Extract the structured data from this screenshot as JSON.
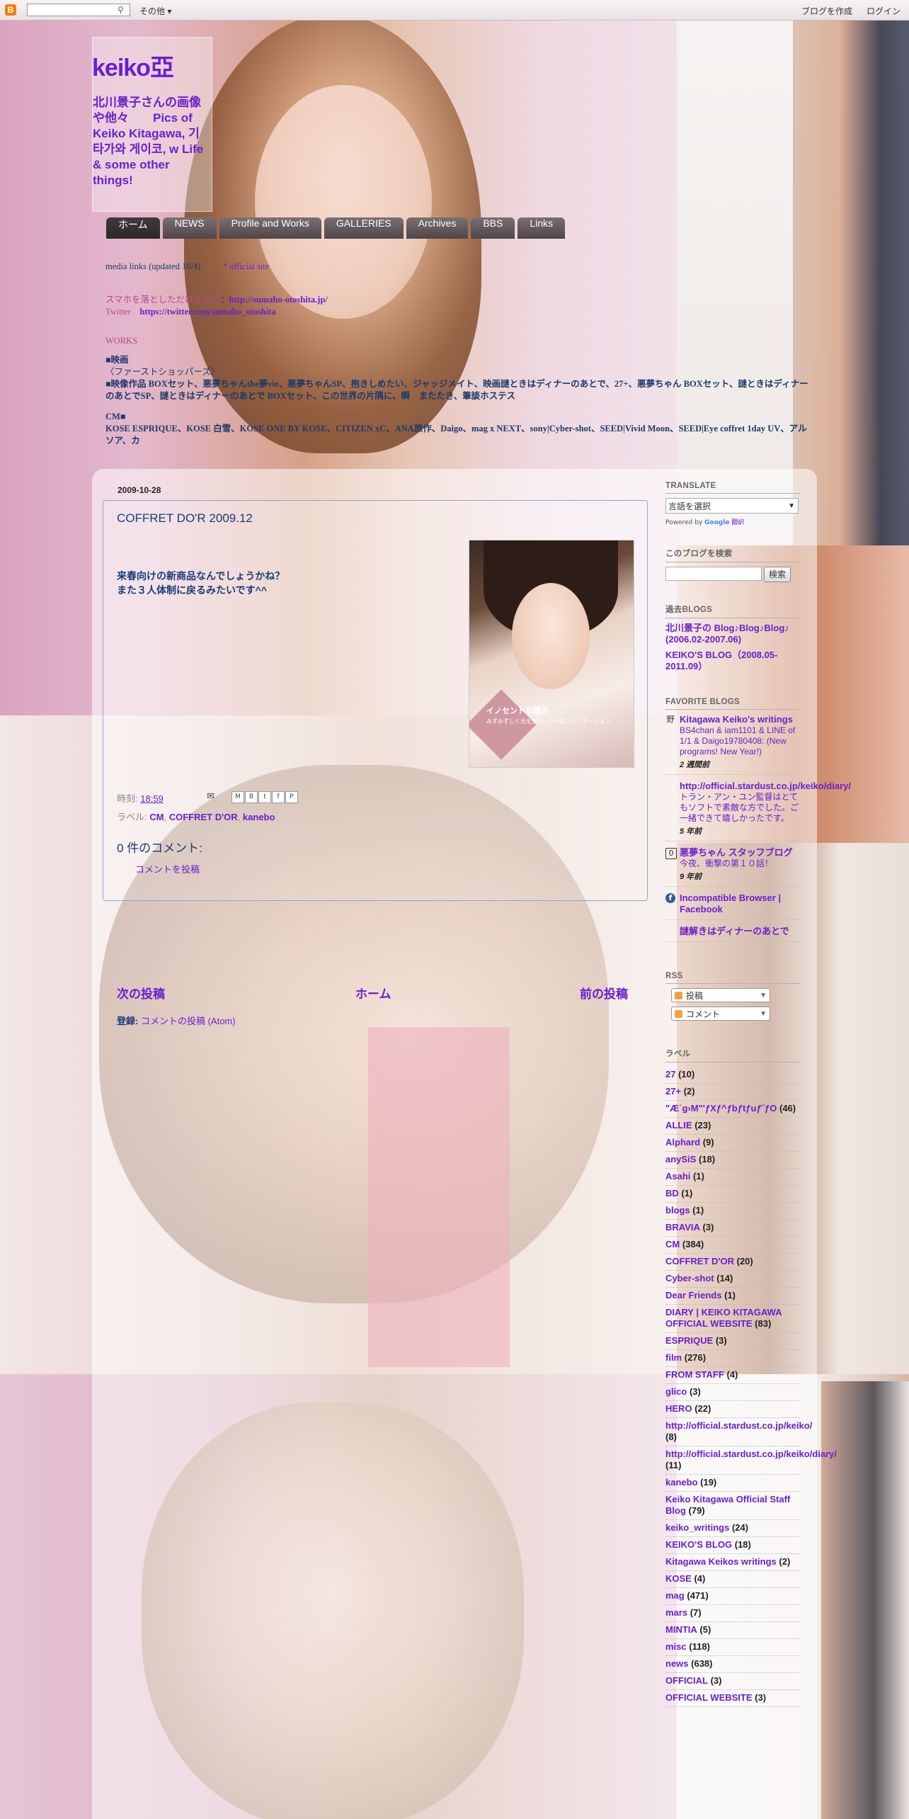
{
  "navbar": {
    "more": "その他",
    "create_blog": "ブログを作成",
    "login": "ログイン"
  },
  "header": {
    "title": "keiko亞",
    "description": "北川景子さんの画像や他々　　Pics of Keiko Kitagawa, 기타가와 게이코, w Life & some other things!"
  },
  "tabs": [
    {
      "label": "ホーム",
      "active": true
    },
    {
      "label": "NEWS"
    },
    {
      "label": "Profile and Works"
    },
    {
      "label": "GALLERIES"
    },
    {
      "label": "Archives"
    },
    {
      "label": "BBS"
    },
    {
      "label": "Links"
    }
  ],
  "info": {
    "line1_a": "media links (updated 10/4)",
    "line1_b": "* official site",
    "line2_label": "スマホを落としただけなのに",
    "line2_url": "：http://sumaho-otoshita.jp/",
    "line3_label": "Twitter",
    "line3_url": "https://twitter.com/sumaho_otoshita",
    "works_head": "WORKS",
    "works_l1": "■映画",
    "works_l2": "〈ファーストショッパーズ〉",
    "works_l3": "■映像作品 BOXセット、悪夢ちゃんthe夢vie、悪夢ちゃんSP、抱きしめたい、ジャッジメイト、映画謎ときはディナーのあとで、27+、悪夢ちゃん BOXセット、謎ときはディナーのあとでSP、謎ときはディナーのあとで BOXセット、この世界の片隅に、瞬　またたき、筆談ホステス",
    "cm_head": "CM■",
    "cm_l1": "KOSE ESPRIQUE、KOSE 白雪、KOSE ONE BY KOSE、CITIZEN xC、ANA旅作、Daigo、mag x NEXT、sony|Cyber-shot、SEED|Vivid Moon、SEED|Eye coffret 1day UV、アルソア、カ"
  },
  "post": {
    "date": "2009-10-28",
    "title": "COFFRET DO'R 2009.12",
    "body_l1": "来春向けの新商品なんでしょうかね？",
    "body_l2": "また３人体制に戻るみたいです^^",
    "image_text": "イノセントな輝き",
    "image_subtext": "みずみずしく光を放つ、ツヤ肌ファンデーション",
    "time_label": "時刻:",
    "time": "18:59",
    "labels_label": "ラベル:",
    "labels": [
      "CM",
      "COFFRET D'OR",
      "kanebo"
    ],
    "comments_count": "0 件のコメント:",
    "post_comment": "コメントを投稿"
  },
  "pager": {
    "newer": "次の投稿",
    "home": "ホーム",
    "older": "前の投稿"
  },
  "feed": {
    "label": "登録:",
    "link": "コメントの投稿 (Atom)"
  },
  "sidebar": {
    "translate_head": "TRANSLATE",
    "translate_select": "言語を選択",
    "powered_by": "Powered by",
    "google": "Google",
    "translate_word": "翻訳",
    "search_head": "このブログを検索",
    "search_button": "検索",
    "past_head": "過去BLOGS",
    "past_links": [
      "北川景子の Blog♪Blog♪Blog♪ (2006.02-2007.06)",
      "KEIKO'S BLOG（2008.05-2011.09）"
    ],
    "fav_head": "FAVORITE BLOGS",
    "fav": [
      {
        "icon": "野",
        "title": "Kitagawa Keiko's writings",
        "snippet": "BS4chan & iam1101 & LINE of 1/1 & Daigo19780408: (New programs! New Year!)",
        "time": "2 週間前"
      },
      {
        "icon": "",
        "title": "http://official.stardust.co.jp/keiko/diary/",
        "snippet": "トラン・アン・ユン監督はとてもソフトで素敵な方でした。ご一緒できて嬉しかったです。",
        "time": "5 年前"
      },
      {
        "icon": "0",
        "title": "悪夢ちゃん スタッフブログ",
        "snippet": "今夜、衝撃の第１０話！",
        "time": "9 年前"
      },
      {
        "icon": "f",
        "title": "Incompatible Browser | Facebook",
        "snippet": "",
        "time": ""
      },
      {
        "icon": "",
        "title": "謎解きはディナーのあとで",
        "snippet": "",
        "time": ""
      }
    ],
    "rss_head": "RSS",
    "rss_posts": "投稿",
    "rss_comments": "コメント",
    "labels_head": "ラベル",
    "labels": [
      {
        "name": "27",
        "count": "(10)"
      },
      {
        "name": "27+",
        "count": "(2)"
      },
      {
        "name": "\"Æ˙g›M\"'ƒXƒ^ƒbƒtƒuƒ˝ƒO",
        "count": "(46)"
      },
      {
        "name": "ALLIE",
        "count": "(23)"
      },
      {
        "name": "Alphard",
        "count": "(9)"
      },
      {
        "name": "anySiS",
        "count": "(18)"
      },
      {
        "name": "Asahi",
        "count": "(1)"
      },
      {
        "name": "BD",
        "count": "(1)"
      },
      {
        "name": "blogs",
        "count": "(1)"
      },
      {
        "name": "BRAVIA",
        "count": "(3)"
      },
      {
        "name": "CM",
        "count": "(384)"
      },
      {
        "name": "COFFRET D'OR",
        "count": "(20)"
      },
      {
        "name": "Cyber-shot",
        "count": "(14)"
      },
      {
        "name": "Dear Friends",
        "count": "(1)"
      },
      {
        "name": "DIARY | KEIKO KITAGAWA OFFICIAL WEBSITE",
        "count": "(83)"
      },
      {
        "name": "ESPRIQUE",
        "count": "(3)"
      },
      {
        "name": "film",
        "count": "(276)"
      },
      {
        "name": "FROM STAFF",
        "count": "(4)"
      },
      {
        "name": "glico",
        "count": "(3)"
      },
      {
        "name": "HERO",
        "count": "(22)"
      },
      {
        "name": "http://official.stardust.co.jp/keiko/",
        "count": "(8)"
      },
      {
        "name": "http://official.stardust.co.jp/keiko/diary/",
        "count": "(11)"
      },
      {
        "name": "kanebo",
        "count": "(19)"
      },
      {
        "name": "Keiko Kitagawa Official Staff Blog",
        "count": "(79)"
      },
      {
        "name": "keiko_writings",
        "count": "(24)"
      },
      {
        "name": "KEIKO'S BLOG",
        "count": "(18)"
      },
      {
        "name": "Kitagawa Keikos writings",
        "count": "(2)"
      },
      {
        "name": "KOSE",
        "count": "(4)"
      },
      {
        "name": "mag",
        "count": "(471)"
      },
      {
        "name": "mars",
        "count": "(7)"
      },
      {
        "name": "MINTIA",
        "count": "(5)"
      },
      {
        "name": "misc",
        "count": "(118)"
      },
      {
        "name": "news",
        "count": "(638)"
      },
      {
        "name": "OFFICIAL",
        "count": "(3)"
      },
      {
        "name": "OFFICIAL WEBSITE",
        "count": "(3)"
      }
    ]
  },
  "colors": {
    "link": "#6a1fd0",
    "text_blue": "#1c3a7a",
    "tab_bg": "#4e4649"
  }
}
